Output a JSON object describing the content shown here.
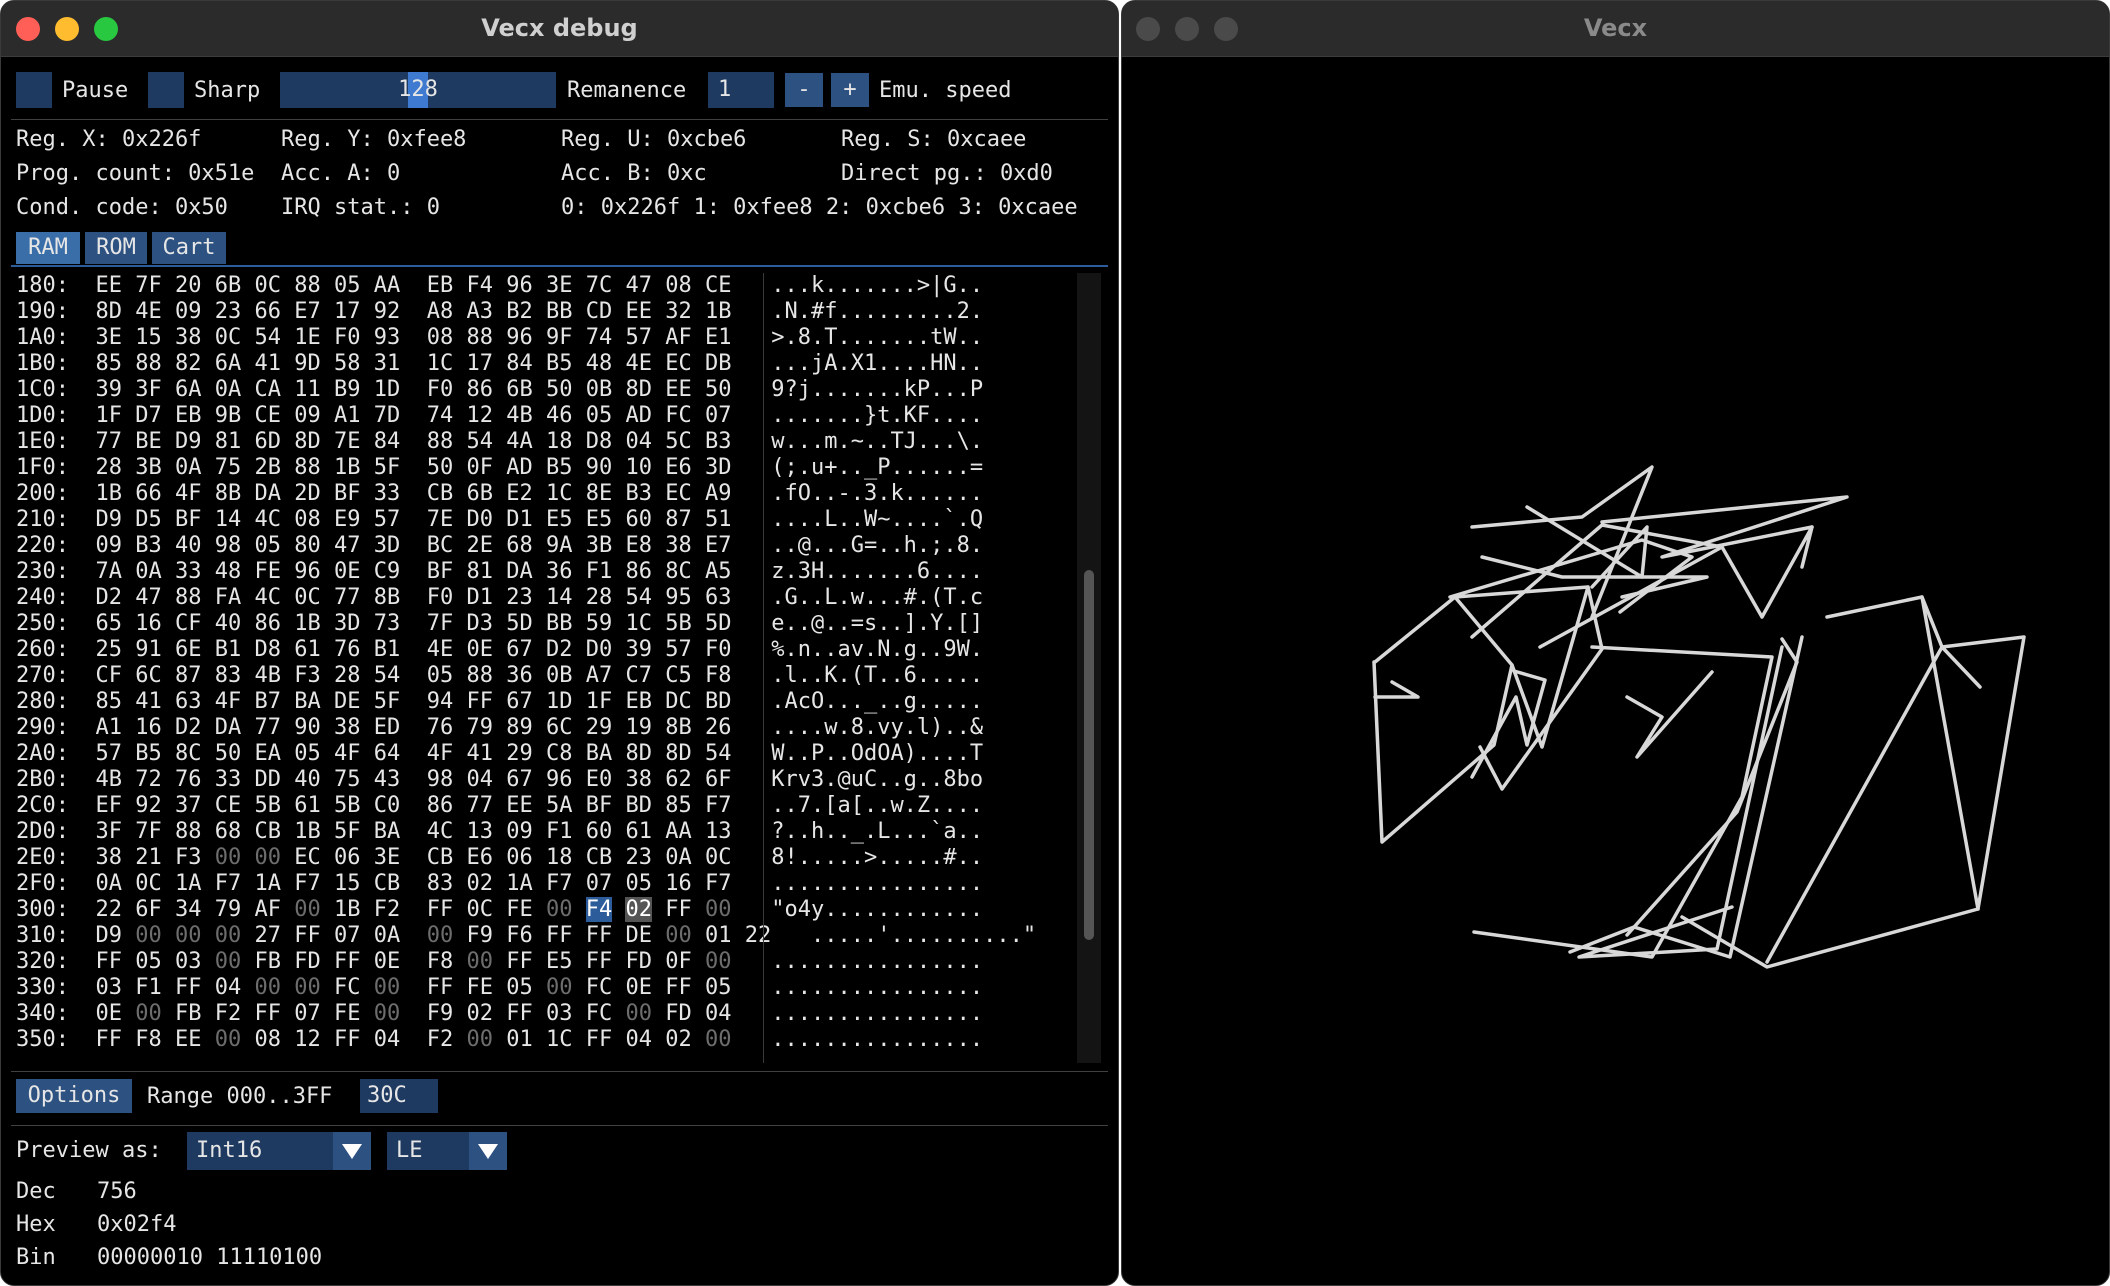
{
  "debug_window": {
    "title": "Vecx debug",
    "toolbar": {
      "pause_label": "Pause",
      "sharp_label": "Sharp",
      "slider_value": "128",
      "remanence_label": "Remanence",
      "remanence_value": "1",
      "minus_label": "-",
      "plus_label": "+",
      "emu_speed_label": "Emu. speed"
    },
    "registers": {
      "reg_x": "Reg. X: 0x226f",
      "reg_y": "Reg. Y: 0xfee8",
      "reg_u": "Reg. U: 0xcbe6",
      "reg_s": "Reg. S: 0xcaee",
      "prog_count": "Prog. count: 0x51e",
      "acc_a": "Acc. A: 0",
      "acc_b": "Acc. B: 0xc",
      "direct_pg": "Direct pg.: 0xd0",
      "cond_code": "Cond. code: 0x50",
      "irq_stat": "IRQ stat.: 0",
      "stack_line": "0: 0x226f 1: 0xfee8 2: 0xcbe6 3: 0xcaee"
    },
    "tabs": [
      "RAM",
      "ROM",
      "Cart"
    ],
    "hex_rows": [
      {
        "addr": "180:",
        "bytes": [
          "EE",
          "7F",
          "20",
          "6B",
          "0C",
          "88",
          "05",
          "AA",
          "EB",
          "F4",
          "96",
          "3E",
          "7C",
          "47",
          "08",
          "CE"
        ],
        "ascii": "...k.......>|G.."
      },
      {
        "addr": "190:",
        "bytes": [
          "8D",
          "4E",
          "09",
          "23",
          "66",
          "E7",
          "17",
          "92",
          "A8",
          "A3",
          "B2",
          "BB",
          "CD",
          "EE",
          "32",
          "1B"
        ],
        "ascii": ".N.#f.........2."
      },
      {
        "addr": "1A0:",
        "bytes": [
          "3E",
          "15",
          "38",
          "0C",
          "54",
          "1E",
          "F0",
          "93",
          "08",
          "88",
          "96",
          "9F",
          "74",
          "57",
          "AF",
          "E1"
        ],
        "ascii": ">.8.T.......tW.."
      },
      {
        "addr": "1B0:",
        "bytes": [
          "85",
          "88",
          "82",
          "6A",
          "41",
          "9D",
          "58",
          "31",
          "1C",
          "17",
          "84",
          "B5",
          "48",
          "4E",
          "EC",
          "DB"
        ],
        "ascii": "...jA.X1....HN.."
      },
      {
        "addr": "1C0:",
        "bytes": [
          "39",
          "3F",
          "6A",
          "0A",
          "CA",
          "11",
          "B9",
          "1D",
          "F0",
          "86",
          "6B",
          "50",
          "0B",
          "8D",
          "EE",
          "50"
        ],
        "ascii": "9?j.......kP...P"
      },
      {
        "addr": "1D0:",
        "bytes": [
          "1F",
          "D7",
          "EB",
          "9B",
          "CE",
          "09",
          "A1",
          "7D",
          "74",
          "12",
          "4B",
          "46",
          "05",
          "AD",
          "FC",
          "07"
        ],
        "ascii": ".......}t.KF...."
      },
      {
        "addr": "1E0:",
        "bytes": [
          "77",
          "BE",
          "D9",
          "81",
          "6D",
          "8D",
          "7E",
          "84",
          "88",
          "54",
          "4A",
          "18",
          "D8",
          "04",
          "5C",
          "B3"
        ],
        "ascii": "w...m.~..TJ...\\."
      },
      {
        "addr": "1F0:",
        "bytes": [
          "28",
          "3B",
          "0A",
          "75",
          "2B",
          "88",
          "1B",
          "5F",
          "50",
          "0F",
          "AD",
          "B5",
          "90",
          "10",
          "E6",
          "3D"
        ],
        "ascii": "(;.u+.._P......="
      },
      {
        "addr": "200:",
        "bytes": [
          "1B",
          "66",
          "4F",
          "8B",
          "DA",
          "2D",
          "BF",
          "33",
          "CB",
          "6B",
          "E2",
          "1C",
          "8E",
          "B3",
          "EC",
          "A9"
        ],
        "ascii": ".fO..-.3.k......"
      },
      {
        "addr": "210:",
        "bytes": [
          "D9",
          "D5",
          "BF",
          "14",
          "4C",
          "08",
          "E9",
          "57",
          "7E",
          "D0",
          "D1",
          "E5",
          "E5",
          "60",
          "87",
          "51"
        ],
        "ascii": "....L..W~....`.Q"
      },
      {
        "addr": "220:",
        "bytes": [
          "09",
          "B3",
          "40",
          "98",
          "05",
          "80",
          "47",
          "3D",
          "BC",
          "2E",
          "68",
          "9A",
          "3B",
          "E8",
          "38",
          "E7"
        ],
        "ascii": "..@...G=..h.;.8."
      },
      {
        "addr": "230:",
        "bytes": [
          "7A",
          "0A",
          "33",
          "48",
          "FE",
          "96",
          "0E",
          "C9",
          "BF",
          "81",
          "DA",
          "36",
          "F1",
          "86",
          "8C",
          "A5"
        ],
        "ascii": "z.3H.......6...."
      },
      {
        "addr": "240:",
        "bytes": [
          "D2",
          "47",
          "88",
          "FA",
          "4C",
          "0C",
          "77",
          "8B",
          "F0",
          "D1",
          "23",
          "14",
          "28",
          "54",
          "95",
          "63"
        ],
        "ascii": ".G..L.w...#.(T.c"
      },
      {
        "addr": "250:",
        "bytes": [
          "65",
          "16",
          "CF",
          "40",
          "86",
          "1B",
          "3D",
          "73",
          "7F",
          "D3",
          "5D",
          "BB",
          "59",
          "1C",
          "5B",
          "5D"
        ],
        "ascii": "e..@..=s..].Y.[]"
      },
      {
        "addr": "260:",
        "bytes": [
          "25",
          "91",
          "6E",
          "B1",
          "D8",
          "61",
          "76",
          "B1",
          "4E",
          "0E",
          "67",
          "D2",
          "D0",
          "39",
          "57",
          "F0"
        ],
        "ascii": "%.n..av.N.g..9W."
      },
      {
        "addr": "270:",
        "bytes": [
          "CF",
          "6C",
          "87",
          "83",
          "4B",
          "F3",
          "28",
          "54",
          "05",
          "88",
          "36",
          "0B",
          "A7",
          "C7",
          "C5",
          "F8"
        ],
        "ascii": ".l..K.(T..6....."
      },
      {
        "addr": "280:",
        "bytes": [
          "85",
          "41",
          "63",
          "4F",
          "B7",
          "BA",
          "DE",
          "5F",
          "94",
          "FF",
          "67",
          "1D",
          "1F",
          "EB",
          "DC",
          "BD"
        ],
        "ascii": ".AcO..._..g....."
      },
      {
        "addr": "290:",
        "bytes": [
          "A1",
          "16",
          "D2",
          "DA",
          "77",
          "90",
          "38",
          "ED",
          "76",
          "79",
          "89",
          "6C",
          "29",
          "19",
          "8B",
          "26"
        ],
        "ascii": "....w.8.vy.l)..&"
      },
      {
        "addr": "2A0:",
        "bytes": [
          "57",
          "B5",
          "8C",
          "50",
          "EA",
          "05",
          "4F",
          "64",
          "4F",
          "41",
          "29",
          "C8",
          "BA",
          "8D",
          "8D",
          "54"
        ],
        "ascii": "W..P..OdOA)....T"
      },
      {
        "addr": "2B0:",
        "bytes": [
          "4B",
          "72",
          "76",
          "33",
          "DD",
          "40",
          "75",
          "43",
          "98",
          "04",
          "67",
          "96",
          "E0",
          "38",
          "62",
          "6F"
        ],
        "ascii": "Krv3.@uC..g..8bo"
      },
      {
        "addr": "2C0:",
        "bytes": [
          "EF",
          "92",
          "37",
          "CE",
          "5B",
          "61",
          "5B",
          "C0",
          "86",
          "77",
          "EE",
          "5A",
          "BF",
          "BD",
          "85",
          "F7"
        ],
        "ascii": "..7.[a[..w.Z...."
      },
      {
        "addr": "2D0:",
        "bytes": [
          "3F",
          "7F",
          "88",
          "68",
          "CB",
          "1B",
          "5F",
          "BA",
          "4C",
          "13",
          "09",
          "F1",
          "60",
          "61",
          "AA",
          "13"
        ],
        "ascii": "?..h.._.L...`a.."
      },
      {
        "addr": "2E0:",
        "bytes": [
          "38",
          "21",
          "F3",
          "00",
          "00",
          "EC",
          "06",
          "3E",
          "CB",
          "E6",
          "06",
          "18",
          "CB",
          "23",
          "0A",
          "0C"
        ],
        "ascii": "8!.....>.....#.."
      },
      {
        "addr": "2F0:",
        "bytes": [
          "0A",
          "0C",
          "1A",
          "F7",
          "1A",
          "F7",
          "15",
          "CB",
          "83",
          "02",
          "1A",
          "F7",
          "07",
          "05",
          "16",
          "F7"
        ],
        "ascii": "................"
      },
      {
        "addr": "300:",
        "bytes": [
          "22",
          "6F",
          "34",
          "79",
          "AF",
          "00",
          "1B",
          "F2",
          "FF",
          "0C",
          "FE",
          "00",
          "F4",
          "02",
          "FF",
          "00"
        ],
        "ascii": "\"o4y............"
      },
      {
        "addr": "310:",
        "bytes": [
          "D9",
          "00",
          "00",
          "00",
          "27",
          "FF",
          "07",
          "0A",
          "00",
          "F9",
          "F6",
          "FF",
          "FF",
          "DE",
          "00",
          "01",
          "22"
        ],
        "ascii": ".....'..........\""
      },
      {
        "addr": "320:",
        "bytes": [
          "FF",
          "05",
          "03",
          "00",
          "FB",
          "FD",
          "FF",
          "0E",
          "F8",
          "00",
          "FF",
          "E5",
          "FF",
          "FD",
          "0F",
          "00"
        ],
        "ascii": "................"
      },
      {
        "addr": "330:",
        "bytes": [
          "03",
          "F1",
          "FF",
          "04",
          "00",
          "00",
          "FC",
          "00",
          "FF",
          "FE",
          "05",
          "00",
          "FC",
          "0E",
          "FF",
          "05"
        ],
        "ascii": "................"
      },
      {
        "addr": "340:",
        "bytes": [
          "0E",
          "00",
          "FB",
          "F2",
          "FF",
          "07",
          "FE",
          "00",
          "F9",
          "02",
          "FF",
          "03",
          "FC",
          "00",
          "FD",
          "04"
        ],
        "ascii": "................"
      },
      {
        "addr": "350:",
        "bytes": [
          "FF",
          "F8",
          "EE",
          "00",
          "08",
          "12",
          "FF",
          "04",
          "F2",
          "00",
          "01",
          "1C",
          "FF",
          "04",
          "02",
          "00"
        ],
        "ascii": "................"
      }
    ],
    "footer": {
      "options_label": "Options",
      "range_label": "Range 000..3FF",
      "goto_value": "30C",
      "preview_as_label": "Preview as:",
      "preview_type": "Int16",
      "endian": "LE",
      "dec_label": "Dec",
      "dec_value": "756",
      "hex_label": "Hex",
      "hex_value": "0x02f4",
      "bin_label": "Bin",
      "bin_value": "00000010 11110100"
    }
  },
  "vecx_window": {
    "title": "Vecx"
  },
  "colors": {
    "close": "#ff5f57",
    "minimize": "#febc2e",
    "zoom": "#28c840",
    "accent": "#2d5281",
    "frame": "#1f3a60"
  }
}
